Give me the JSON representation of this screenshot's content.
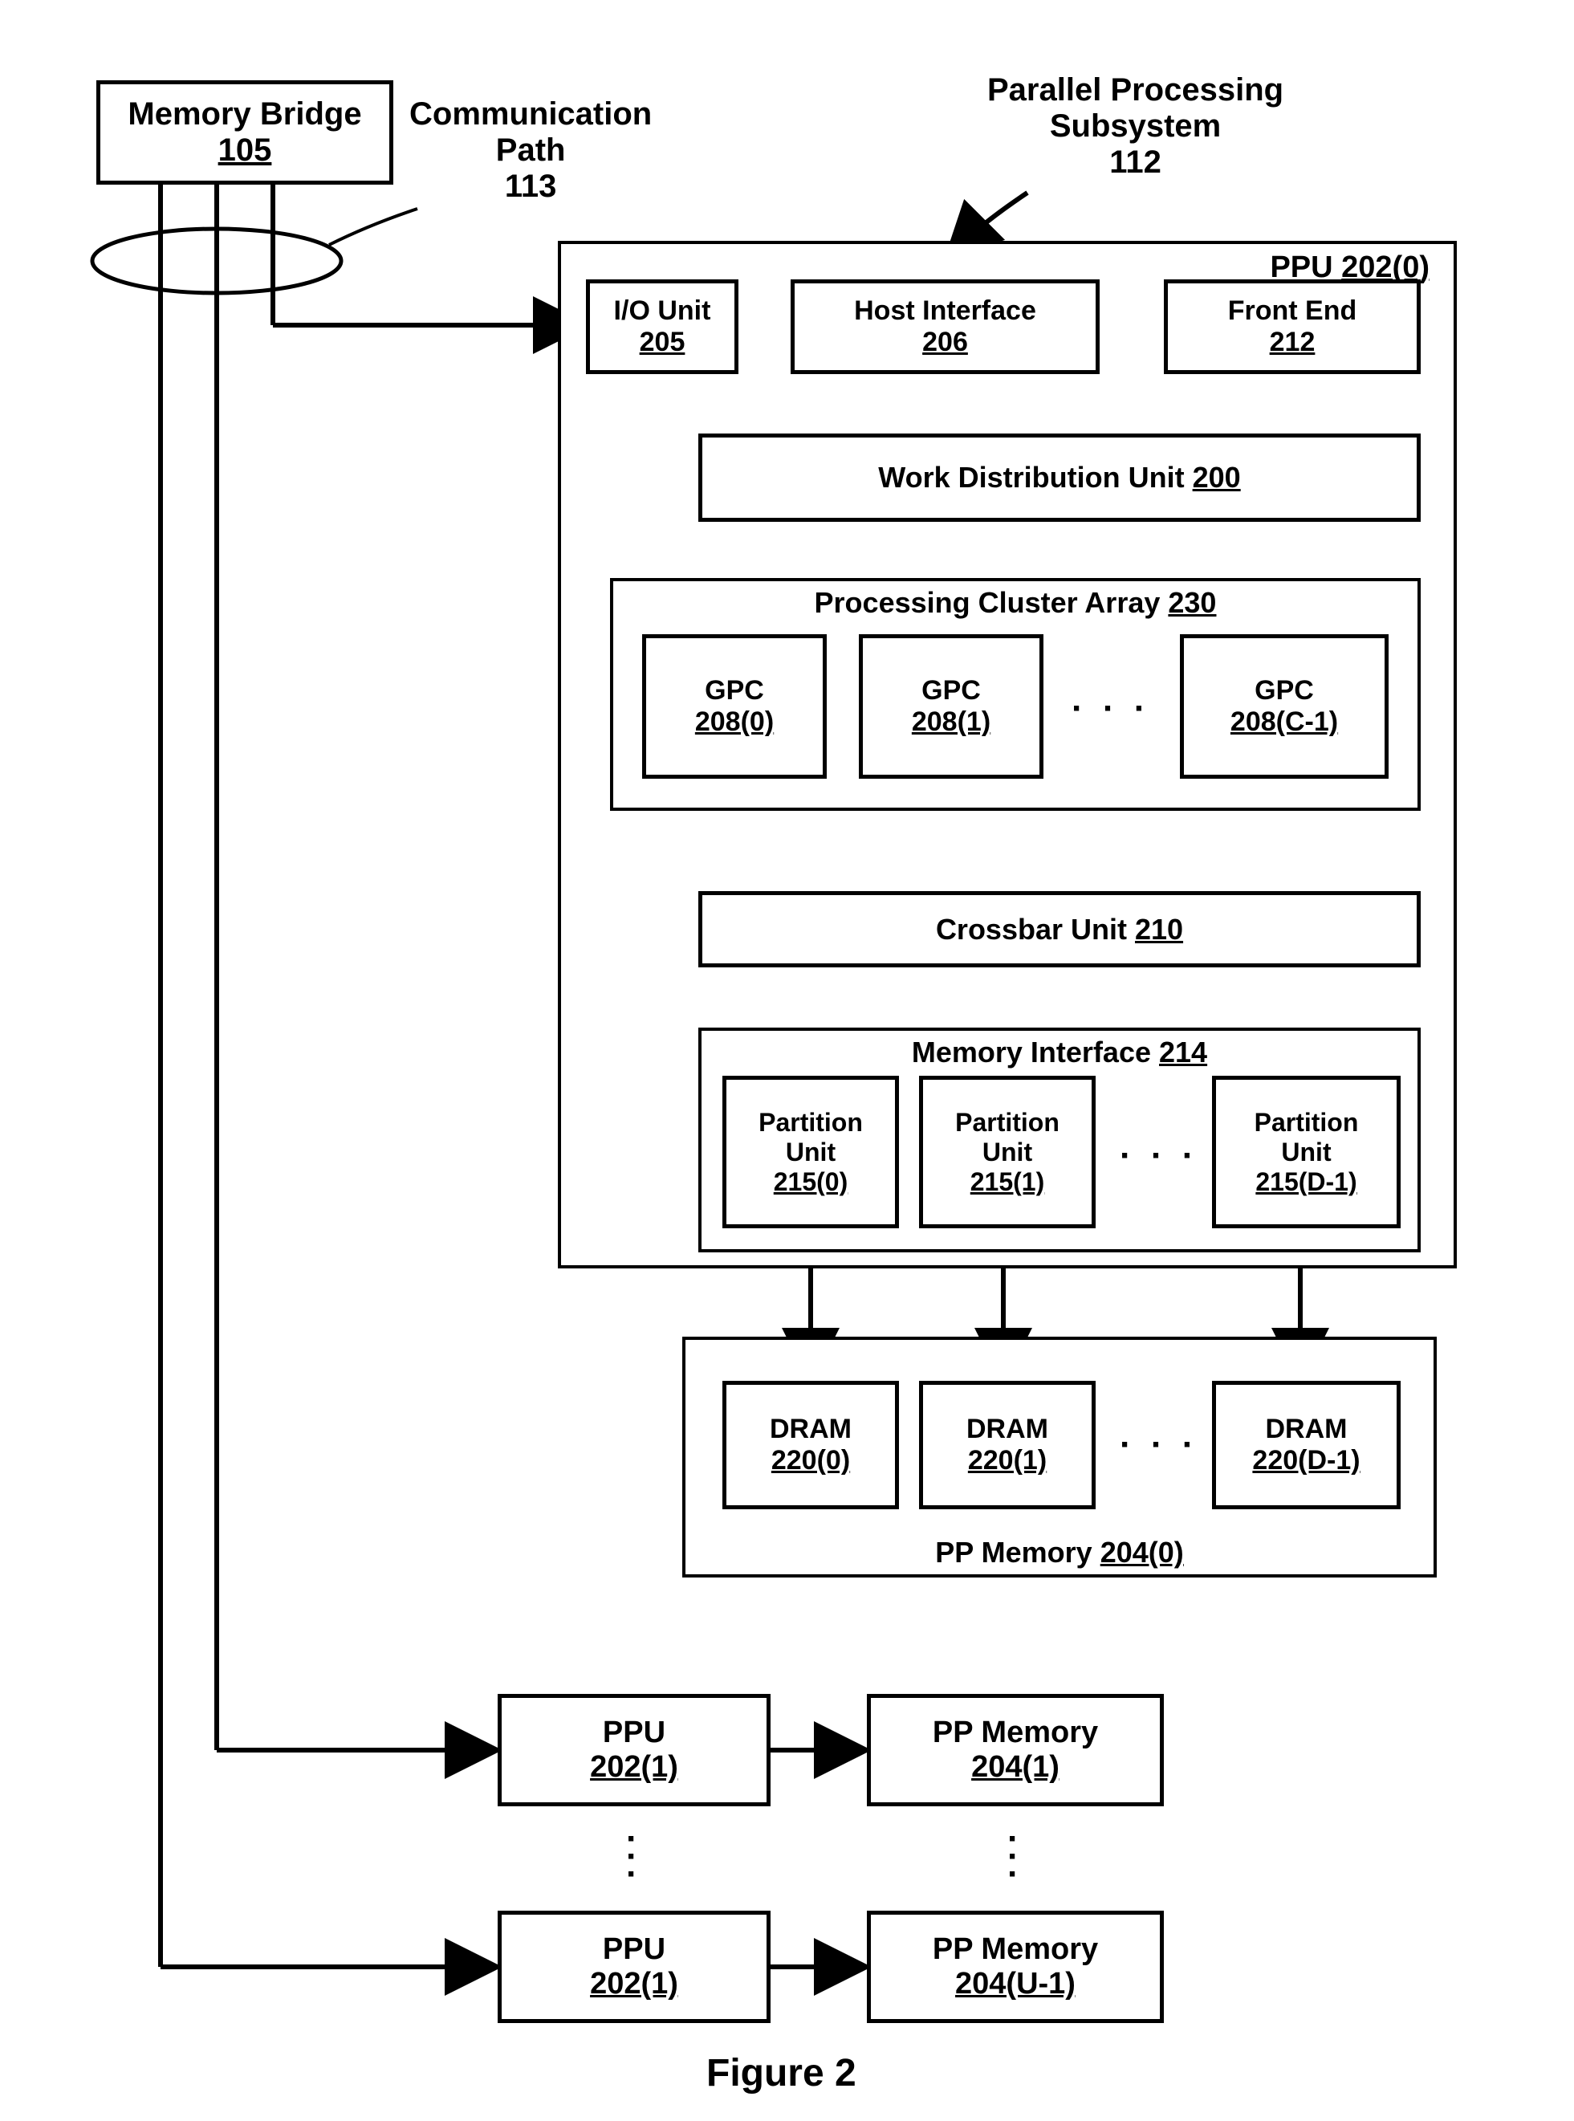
{
  "mem_bridge": {
    "title": "Memory Bridge",
    "ref": "105"
  },
  "comm_path": {
    "title": "Communication",
    "title2": "Path",
    "ref": "113"
  },
  "subsystem": {
    "title": "Parallel Processing",
    "title2": "Subsystem",
    "ref": "112"
  },
  "ppu0": {
    "title": "PPU",
    "ref": "202(0)"
  },
  "io_unit": {
    "title": "I/O Unit",
    "ref": "205"
  },
  "host_if": {
    "title": "Host Interface",
    "ref": "206"
  },
  "front_end": {
    "title": "Front End",
    "ref": "212"
  },
  "wdu": {
    "title": "Work Distribution Unit",
    "ref": "200"
  },
  "pca": {
    "title": "Processing Cluster Array",
    "ref": "230"
  },
  "gpc0": {
    "title": "GPC",
    "ref": "208(0)"
  },
  "gpc1": {
    "title": "GPC",
    "ref": "208(1)"
  },
  "gpcC": {
    "title": "GPC",
    "ref": "208(C-1)"
  },
  "xbar": {
    "title": "Crossbar Unit",
    "ref": "210"
  },
  "memif": {
    "title": "Memory Interface",
    "ref": "214"
  },
  "pu0": {
    "title": "Partition",
    "title2": "Unit",
    "ref": "215(0)"
  },
  "pu1": {
    "title": "Partition",
    "title2": "Unit",
    "ref": "215(1)"
  },
  "puD": {
    "title": "Partition",
    "title2": "Unit",
    "ref": "215(D-1)"
  },
  "dram0": {
    "title": "DRAM",
    "ref": "220(0)"
  },
  "dram1": {
    "title": "DRAM",
    "ref": "220(1)"
  },
  "dramD": {
    "title": "DRAM",
    "ref": "220(D-1)"
  },
  "ppmem0": {
    "title": "PP Memory",
    "ref": "204(0)"
  },
  "ppu1": {
    "title": "PPU",
    "ref": "202(1)"
  },
  "ppmem1": {
    "title": "PP Memory",
    "ref": "204(1)"
  },
  "ppuU": {
    "title": "PPU",
    "ref": "202(1)"
  },
  "ppmemU": {
    "title": "PP Memory",
    "ref": "204(U-1)"
  },
  "figure": "Figure 2"
}
